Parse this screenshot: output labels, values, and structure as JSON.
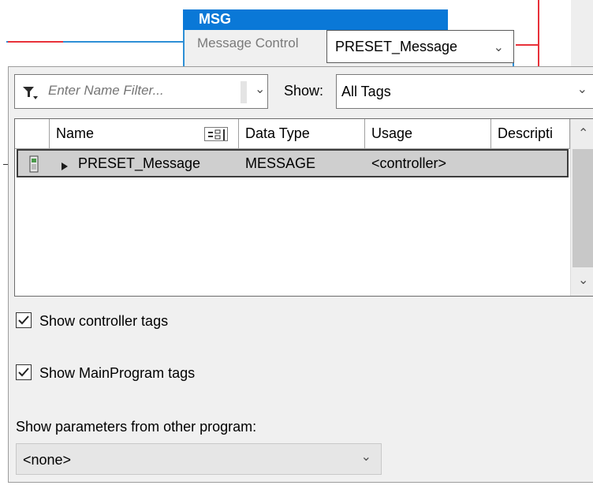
{
  "msg_block": {
    "title": "MSG",
    "control_label": "Message Control",
    "control_value": "PRESET_Message"
  },
  "colors": {
    "msg_header": "#0a78d7",
    "rung_blue": "#2e8fd6",
    "rung_red": "#e8323a",
    "selected_row": "#cfcfcf"
  },
  "filter": {
    "placeholder": "Enter Name Filter..."
  },
  "show": {
    "label": "Show:",
    "value": "All Tags"
  },
  "grid": {
    "columns": [
      "Name",
      "Data Type",
      "Usage",
      "Descripti"
    ],
    "rows": [
      {
        "name": "PRESET_Message",
        "data_type": "MESSAGE",
        "usage": "<controller>",
        "description": ""
      }
    ]
  },
  "options": {
    "show_controller_tags": {
      "label": "Show controller tags",
      "checked": true
    },
    "show_mainprogram_tags": {
      "label": "Show MainProgram tags",
      "checked": true
    }
  },
  "params": {
    "label": "Show parameters from other program:",
    "value": "<none>"
  }
}
